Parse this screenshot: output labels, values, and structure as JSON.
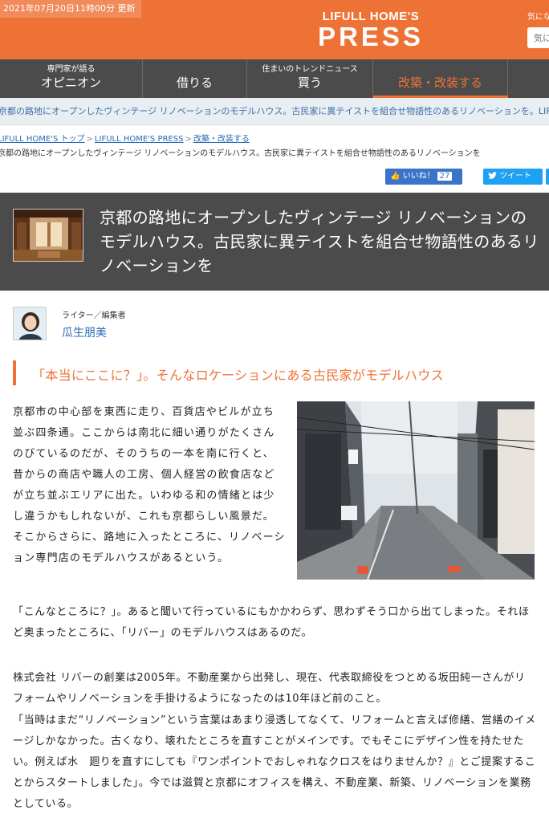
{
  "header": {
    "timestamp": "2021年07月20日11時00分 更新",
    "logo_top": "LIFULL HOME'S",
    "logo_bottom": "PRESS",
    "kininaru": "気になる",
    "search_placeholder": "気に",
    "brand_color": "#ee7236"
  },
  "nav": {
    "items": [
      {
        "sub": "専門家が語る",
        "label": "オピニオン"
      },
      {
        "sub": "",
        "label": "借りる"
      },
      {
        "sub": "住まいのトレンドニュース",
        "label": "買う"
      },
      {
        "sub": "",
        "label": "改築・改装する"
      }
    ],
    "active_index": 3
  },
  "ticker": {
    "text": "京都の路地にオープンしたヴィンテージ リノベーションのモデルハウス。古民家に異テイストを組合せ物語性のあるリノベーションを。LIFULL"
  },
  "breadcrumb": {
    "items": [
      "LIFULL HOME'S トップ",
      "LIFULL HOME'S PRESS",
      "改築・改装する"
    ],
    "current": "京都の路地にオープンしたヴィンテージ リノベーションのモデルハウス。古民家に異テイストを組合せ物語性のあるリノベーションを"
  },
  "social": {
    "like_label": "いいね！",
    "like_count": "27",
    "tweet_label": "ツイート"
  },
  "article": {
    "title": "京都の路地にオープンしたヴィンテージ リノベーションのモデルハウス。古民家に異テイストを組合せ物語性のあるリノベーションを",
    "author_role": "ライター／編集者",
    "author_name": "瓜生朋美",
    "section_heading": "「本当にここに？」。そんなロケーションにある古民家がモデルハウス",
    "para1": "京都市の中心部を東西に走り、百貨店やビルが立ち並ぶ四条通。ここからは南北に細い通りがたくさんのびているのだが、そのうちの一本を南に行くと、昔からの商店や職人の工房、個人経営の飲食店などが立ち並ぶエリアに出た。いわゆる和の情緒とは少し違うかもしれないが、これも京都らしい風景だ。そこからさらに、路地に入ったところに、リノベーション専門店のモデルハウスがあるという。",
    "para2": "「こんなところに？」。あると聞いて行っているにもかかわらず、思わずそう口から出てしまった。それほど奥まったところに、「リバー」のモデルハウスはあるのだ。",
    "para3": "株式会社 リバーの創業は2005年。不動産業から出発し、現在、代表取締役をつとめる坂田純一さんがリフォームやリノベーションを手掛けるようになったのは10年ほど前のこと。",
    "para4": "「当時はまだ“リノベーション”という言葉はあまり浸透してなくて、リフォームと言えば修繕、営繕のイメージしかなかった。古くなり、壊れたところを直すことがメインです。でもそこにデザイン性を持たせたい。例えば水　廻りを直すにしても『ワンポイントでおしゃれなクロスをはりませんか？』とご提案することからスタートしました」。今では滋賀と京都にオフィスを構え、不動産業、新築、リノベーションを業務としている。"
  }
}
